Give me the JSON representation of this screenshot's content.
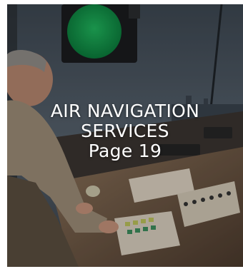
{
  "card": {
    "title_line1": "AIR NAVIGATION",
    "title_line2": "SERVICES",
    "title_line3": "Page 19"
  },
  "colors": {
    "overlay_text": "#ffffff",
    "sky": "#55606b",
    "signal_green": "#0f9a4c",
    "console": "#6b5a4a"
  },
  "icons": {
    "signal_lamp": "traffic-light-icon"
  }
}
